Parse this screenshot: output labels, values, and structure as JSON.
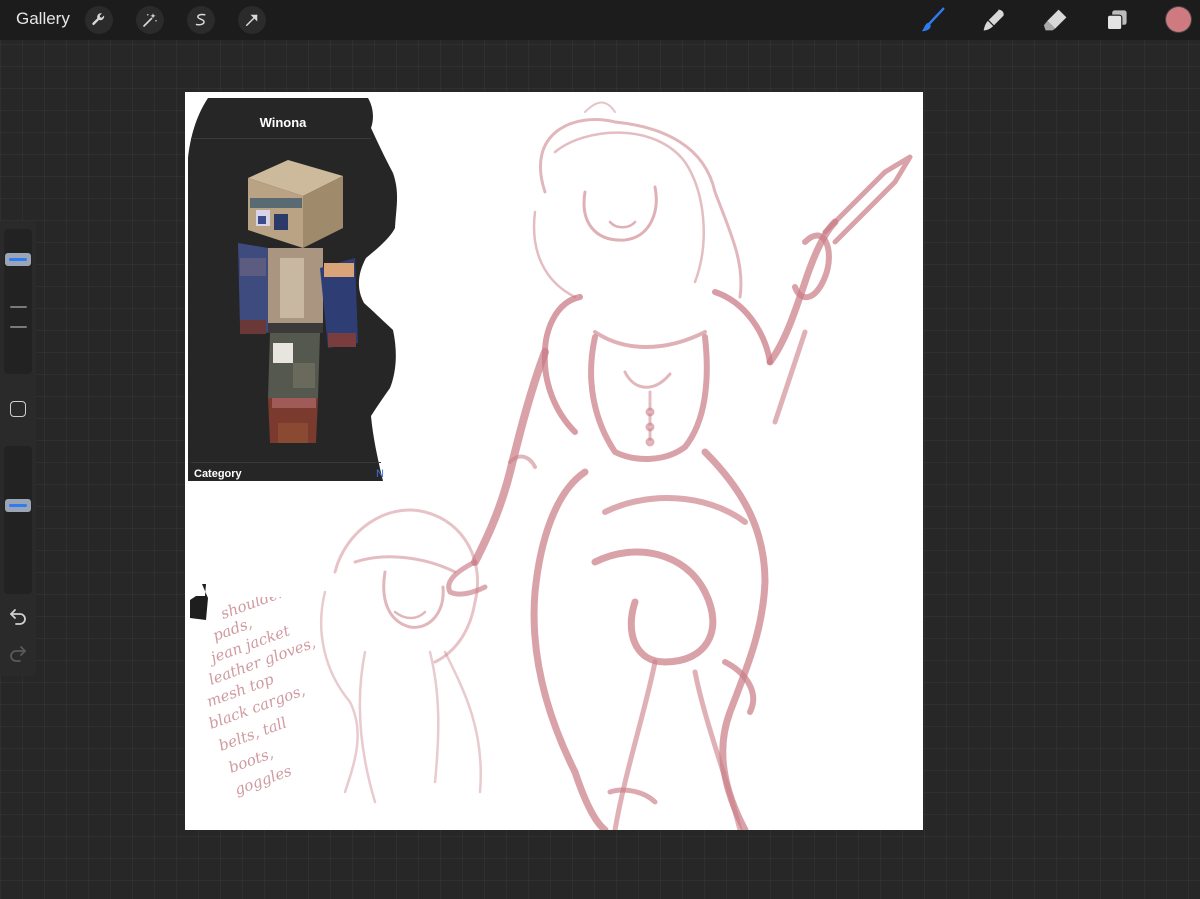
{
  "topbar": {
    "gallery_label": "Gallery",
    "left_tools": [
      "wrench-icon",
      "magic-wand-icon",
      "selection-icon",
      "transform-arrow-icon"
    ],
    "right_tools": [
      "brush-icon",
      "smudge-icon",
      "eraser-icon",
      "layers-icon"
    ],
    "active_tool": "brush-icon",
    "accent_color": "#2f7cf0",
    "current_color": "#cf7a80"
  },
  "sidebar": {
    "brush_size_level": 0.84,
    "opacity_level": 0.6,
    "modify_icon": "square-icon",
    "undo_icon": "undo-icon",
    "redo_icon": "redo-icon"
  },
  "reference": {
    "character_name": "Winona",
    "category_label": "Category",
    "partial_text": "N"
  },
  "notes": {
    "lines": [
      "shoulder",
      "pads,",
      "jean jacket",
      "leather gloves,",
      "mesh top",
      "black cargos,",
      "belts, tall",
      "boots,",
      "goggles"
    ],
    "ink_color": "#cf9aa0"
  },
  "sketch": {
    "stroke_color": "#c97b85"
  }
}
